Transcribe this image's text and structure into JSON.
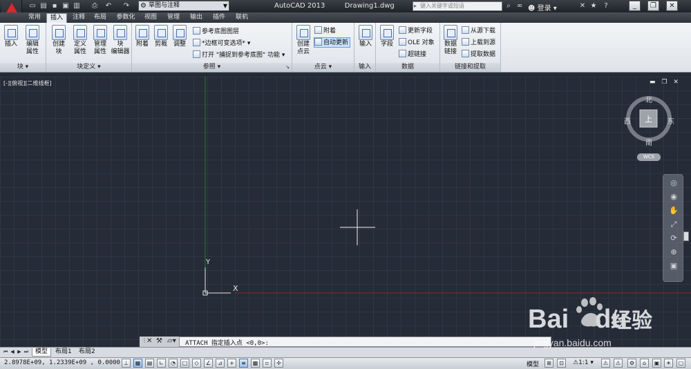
{
  "app": {
    "title": "AutoCAD 2013",
    "document": "Drawing1.dwg",
    "workspace": "草图与注释",
    "search_placeholder": "键入关键字或短语",
    "login": "登录"
  },
  "quick_access": [
    "new-icon",
    "open-icon",
    "save-icon",
    "saveas-icon",
    "plot-icon",
    "undo-icon",
    "redo-icon"
  ],
  "tabs": [
    "常用",
    "插入",
    "注释",
    "布局",
    "参数化",
    "视图",
    "管理",
    "输出",
    "插件",
    "联机"
  ],
  "active_tab": "插入",
  "panels": {
    "block": {
      "title": "块",
      "insert": "插入",
      "edit_attr": [
        "编辑",
        "属性"
      ]
    },
    "block_def": {
      "title": "块定义",
      "create": [
        "创建",
        "块"
      ],
      "define_attr": [
        "定义",
        "属性"
      ],
      "manage_attr": [
        "管理",
        "属性"
      ],
      "block_editor": [
        "块",
        "编辑器"
      ]
    },
    "reference": {
      "title": "参照",
      "attach": "附着",
      "clip": "剪裁",
      "adjust": "调整",
      "underlay_layers": "参考底图图层",
      "frame_var": "*边框可变选项*",
      "snap_underlay": "打开 \"捕捉到参考底图\" 功能"
    },
    "pointcloud": {
      "title": "点云",
      "create": [
        "创建",
        "点云"
      ],
      "attach": "附着",
      "auto_update": "自动更新"
    },
    "import": {
      "title": "输入",
      "import": "输入"
    },
    "data": {
      "title": "数据",
      "field": "字段",
      "update_fields": "更新字段",
      "ole": "OLE 对象",
      "hyperlink": "超链接"
    },
    "linking": {
      "title": "链接和提取",
      "data_link": [
        "数据",
        "链接"
      ],
      "download": "从源下载",
      "upload": "上载到源",
      "extract": "提取数据"
    }
  },
  "viewport": {
    "label": "[-][俯视][二维线框]",
    "compass": {
      "n": "北",
      "s": "南",
      "e": "东",
      "w": "西",
      "center": "上"
    },
    "wcs": "WCS",
    "ucs_x": "X",
    "ucs_y": "Y"
  },
  "command": {
    "text": "ATTACH 指定插入点 <0,0>:"
  },
  "layout_tabs": [
    "模型",
    "布局1",
    "布局2"
  ],
  "status": {
    "coords": "2.8978E+09,  1.2339E+09 , 0.0000",
    "model": "模型",
    "scale": "1:1"
  },
  "watermark": {
    "brand": "Bai",
    "brand2": "du",
    "cn": "经验",
    "url": "jingyan.baidu.com"
  },
  "colors": {
    "canvas": "#252b37",
    "grid": "#2f3645",
    "y_axis": "#2c7a2c",
    "x_axis": "#8a2a2a"
  }
}
